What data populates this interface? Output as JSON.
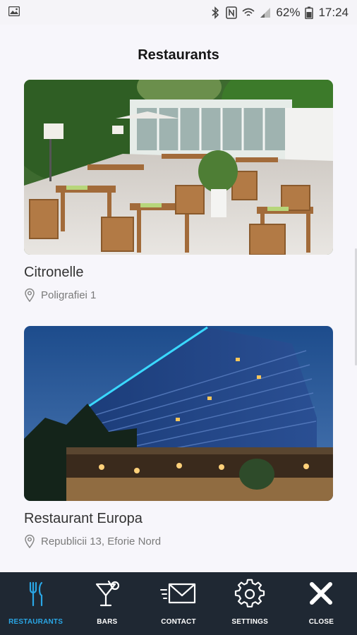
{
  "status_bar": {
    "battery": "62%",
    "time": "17:24",
    "icons": [
      "image-icon",
      "bluetooth-icon",
      "nfc-icon",
      "wifi-icon",
      "signal-icon",
      "battery-icon"
    ]
  },
  "header": {
    "title": "Restaurants"
  },
  "restaurants": [
    {
      "name": "Citronelle",
      "address": "Poligrafiei 1",
      "image": "outdoor-terrace-photo"
    },
    {
      "name": "Restaurant Europa",
      "address": "Republicii 13, Eforie Nord",
      "image": "hotel-night-photo"
    }
  ],
  "bottom_nav": {
    "items": [
      {
        "label": "RESTAURANTS",
        "icon": "fork-knife-icon",
        "active": true
      },
      {
        "label": "BARS",
        "icon": "cocktail-icon",
        "active": false
      },
      {
        "label": "CONTACT",
        "icon": "envelope-icon",
        "active": false
      },
      {
        "label": "SETTINGS",
        "icon": "gear-icon",
        "active": false
      },
      {
        "label": "CLOSE",
        "icon": "close-icon",
        "active": false
      }
    ],
    "active_color": "#2aa7e6",
    "background": "#1f2833"
  }
}
